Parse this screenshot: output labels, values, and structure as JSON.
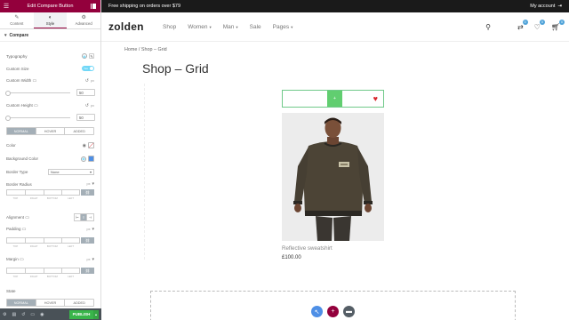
{
  "panel": {
    "header_title": "Edit Compare Button",
    "tabs": [
      {
        "label": "Content",
        "icon": "pencil-icon"
      },
      {
        "label": "Style",
        "icon": "half-circle-icon"
      },
      {
        "label": "Advanced",
        "icon": "gear-icon"
      }
    ],
    "section_compare": "Compare",
    "typography_label": "Typography",
    "custom_size_label": "Custom Size",
    "custom_size_toggle": "Yes",
    "custom_width_label": "Custom Width",
    "custom_width_value": "50",
    "custom_height_label": "Custom Height",
    "custom_height_value": "50",
    "unit_px": "px",
    "state_tabs": [
      "NORMAL",
      "HOVER",
      "ADDED"
    ],
    "color_label": "Color",
    "background_color_label": "Background Color",
    "border_type_label": "Border Type",
    "border_type_value": "None",
    "border_radius_label": "Border Radius",
    "dims_labels": [
      "TOP",
      "RIGHT",
      "BOTTOM",
      "LEFT"
    ],
    "alignment_label": "Alignment",
    "padding_label": "Padding",
    "margin_label": "Margin",
    "state_section_label": "State",
    "state_tabs_2": [
      "NORMAL",
      "HOVER",
      "ADDED"
    ],
    "publish_label": "PUBLISH"
  },
  "site": {
    "topbar_text": "Free shipping on orders over $79",
    "account_label": "My account",
    "logo": "zolden",
    "nav": [
      {
        "label": "Shop",
        "has_dropdown": false
      },
      {
        "label": "Women",
        "has_dropdown": true
      },
      {
        "label": "Man",
        "has_dropdown": true
      },
      {
        "label": "Sale",
        "has_dropdown": false
      },
      {
        "label": "Pages",
        "has_dropdown": true
      }
    ],
    "compare_count": "0",
    "wishlist_count": "0",
    "cart_count": "0",
    "breadcrumb": "Home / Shop – Grid",
    "page_title": "Shop – Grid",
    "compare_button_label": "+",
    "product_name": "Reflective sweatshirt",
    "product_price": "£100.00"
  },
  "colors": {
    "elementor_header": "#93003c",
    "compare_button": "#61ce70",
    "heart": "#d9262c",
    "publish": "#39b54a",
    "fab_blue": "#4e8fe6",
    "fab_maroon": "#93003c",
    "fab_dark": "#555e66"
  }
}
